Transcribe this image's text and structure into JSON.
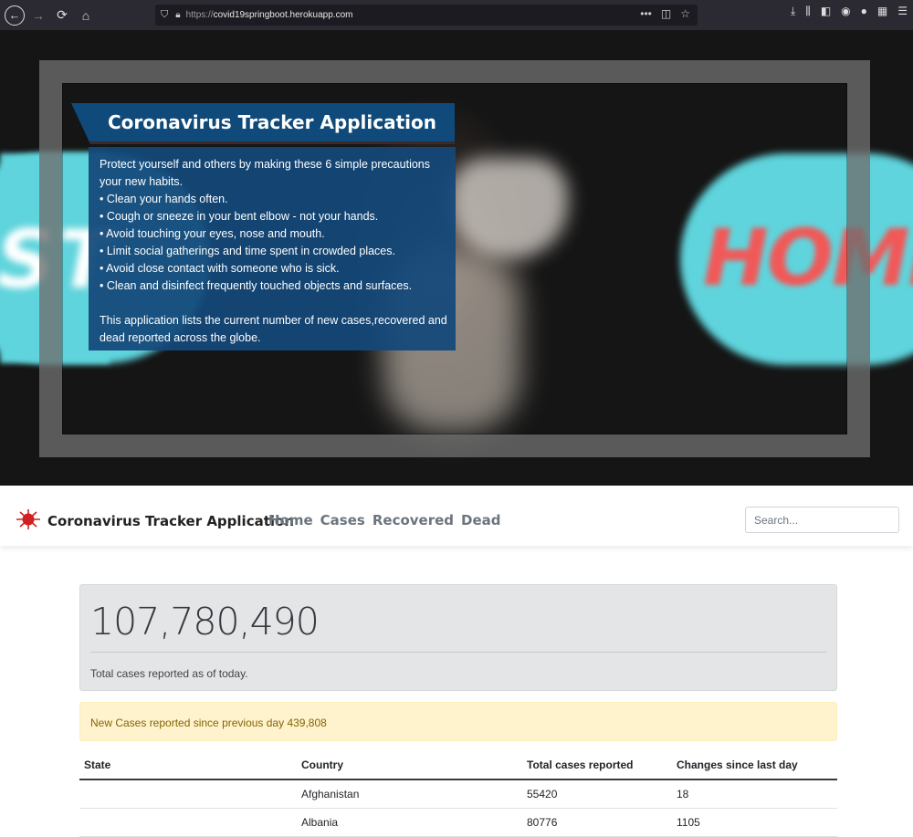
{
  "browser": {
    "url_proto": "https://",
    "url_host": "covid19springboot.herokuapp.com",
    "more_label": "•••"
  },
  "hero": {
    "title": "Coronavirus Tracker Application",
    "intro_lines": [
      "Protect yourself and others by making these 6 simple precautions",
      "your new habits."
    ],
    "precautions": [
      "• Clean your hands often.",
      "• Cough or sneeze in your bent elbow - not your hands.",
      "• Avoid touching your eyes, nose and mouth.",
      "• Limit social gatherings and time spent in crowded places.",
      "• Avoid close contact with someone who is sick.",
      "• Clean and disinfect frequently touched objects and surfaces."
    ],
    "outro_lines": [
      "This application lists the current number of new cases,recovered and",
      "dead reported across the globe."
    ],
    "bg_text_left": "ST",
    "bg_text_right": "HOME"
  },
  "navbar": {
    "brand": "Coronavirus Tracker Application",
    "links": [
      "Home",
      "Cases",
      "Recovered",
      "Dead"
    ],
    "search_placeholder": "Search..."
  },
  "summary": {
    "total_cases": "107,780,490",
    "total_label": "Total cases reported as of today.",
    "new_cases_text": "New Cases reported since previous day 439,808"
  },
  "table": {
    "headers": [
      "State",
      "Country",
      "Total cases reported",
      "Changes since last day"
    ],
    "rows": [
      {
        "state": "",
        "country": "Afghanistan",
        "total": "55420",
        "change": "18"
      },
      {
        "state": "",
        "country": "Albania",
        "total": "80776",
        "change": "1105"
      }
    ]
  },
  "colors": {
    "info_blue": "#13487a",
    "alert_bg": "#fff3cd",
    "alert_text": "#856404",
    "brand_virus": "#d21f1f"
  }
}
